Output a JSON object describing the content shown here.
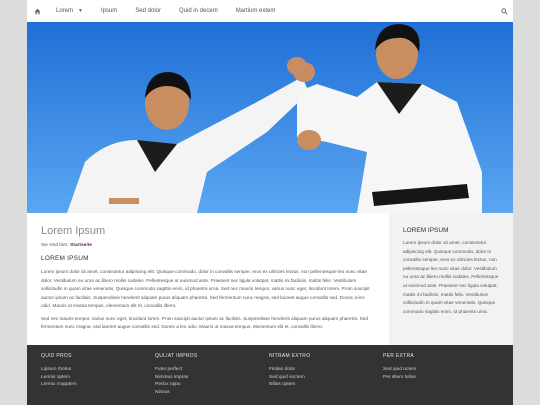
{
  "nav": {
    "items": [
      {
        "label": "Lorem",
        "has_dropdown": true
      },
      {
        "label": "Ipsum"
      },
      {
        "label": "Sed dolor"
      },
      {
        "label": "Quid in decem"
      },
      {
        "label": "Martium extem"
      }
    ]
  },
  "main": {
    "title": "Lorem Ipsum",
    "breadcrumb_prefix": "Sie sind hier:",
    "breadcrumb_link": "Startseite",
    "section_heading": "LOREM IPSUM",
    "paragraph_1": "Lorem ipsum dolor sit amet, consectetur adipiscing elit. Quisque commodo, dolor in convallis semper, eros ex ultricies lectus, non pellentesque leo nunc vitae dolor. Vestibulum eu urna ac libero mollis sodales. Pellentesque ut euismod ante. Praesent nec ligula volutpat, mattis mi facilisis, mattis felis. Vestibulum sollicitudin in quam vitae venenatis. Quisque commodo sagittis enim, id pharetra urna. Sed nec mauris tempor, varius nunc eget, tincidunt lorem. Proin suscipit auctor ipsum ac facilisis. Suspendisse hendrerit aliquam purus aliquam pharetra. Sed fermentum nunc magna, sed laoreet augue convallis sed. Donec a leo odio. Mauris ut massa tempus, elementum elit et, convallis libero.",
    "paragraph_2": "Sed nec mauris tempor, varius nunc eget, tincidunt lorem. Proin suscipit auctor ipsum ac facilisis. Suspendisse hendrerit aliquam purus aliquam pharetra. Sed fermentum nunc magna, sed laoreet augue convallis sed. Donec a leo odio. Mauris ut massa tempus, elementum elit et, convallis libero."
  },
  "sidebar": {
    "heading": "LOREM IPSUM",
    "text": "Lorem ipsum dolor sit amet, consectetur adipiscing elit. Quisque commodo, dolor in convallis semper, eros ex ultricies lectus, non pellentesque leo nunc vitae dolor. Vestibulum eu urna ac libero mollis sodales. Pellentesque ut euismod ante. Praesent nec ligula volutpat, mattis mi facilisis, mattis felis. Vestibulum sollicitudin in quam vitae venenatis. Quisque commodo sagittis enim, id pharetra urna."
  },
  "footer": {
    "columns": [
      {
        "heading": "QUID PROS",
        "links": [
          "Lipsum rhotus",
          "Lermis optem",
          "Lermix mopptem"
        ]
      },
      {
        "heading": "QULIAT IMPROS",
        "links": [
          "Futur perfect",
          "Nimmus impras",
          "Perlox oppo",
          "Nimius"
        ]
      },
      {
        "heading": "NITRAM EXTRO",
        "links": [
          "Finitas dolor",
          "Sed quid exctem",
          "Nillas optem"
        ]
      },
      {
        "heading": "PER EXTRA",
        "links": [
          "Sed quid octem",
          "Per sltem tulios"
        ]
      }
    ]
  },
  "colors": {
    "footer_bg": "#333333",
    "sidebar_bg": "#f2f2f2",
    "sky": "#2f86e6",
    "breadcrumb_link": "#6a1b6a"
  },
  "icons": {
    "home": "home-icon",
    "search": "search-icon",
    "dropdown": "chevron-down-icon"
  }
}
